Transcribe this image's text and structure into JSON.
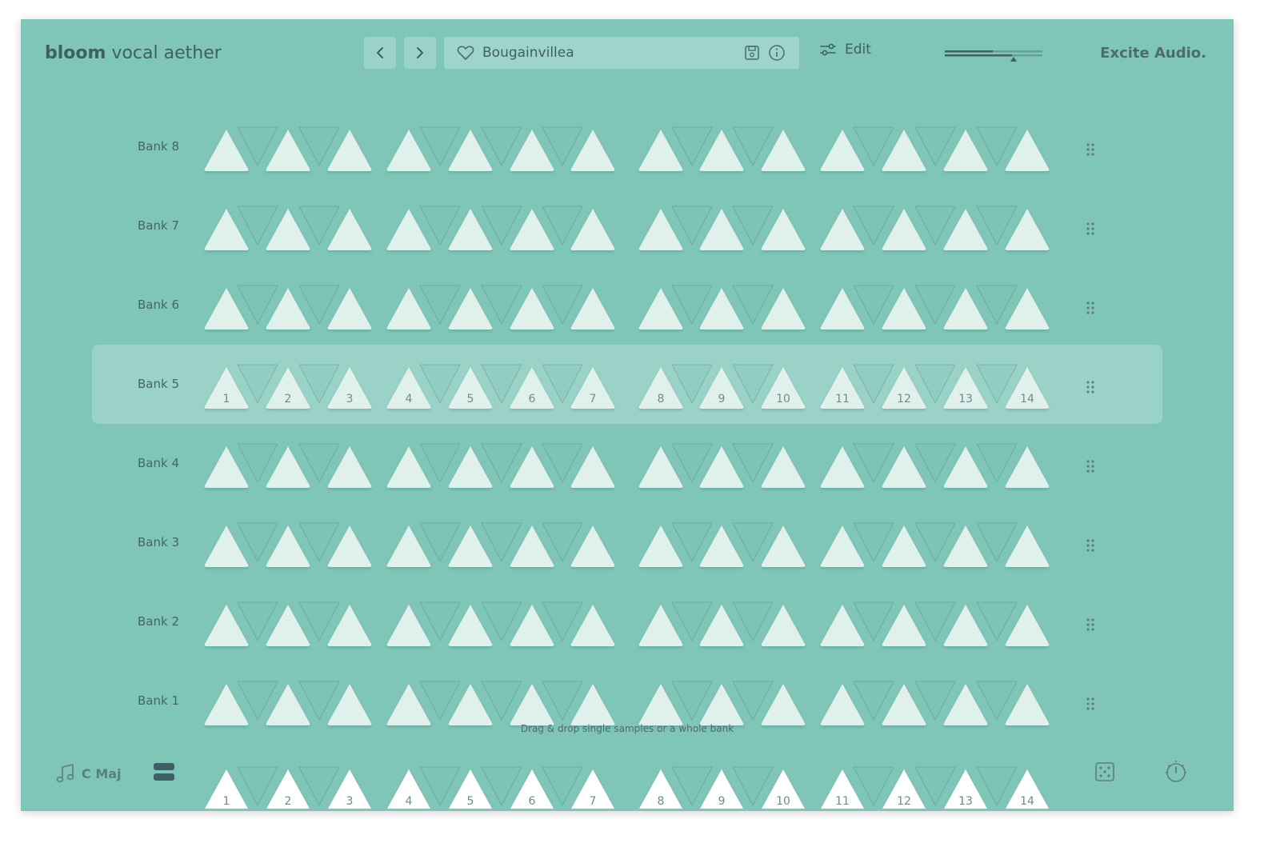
{
  "header": {
    "brand_bold": "bloom",
    "brand_light": "vocal aether",
    "preset_name": "Bougainvillea",
    "edit_label": "Edit",
    "vendor": "Excite Audio."
  },
  "banks": [
    {
      "label": "Bank 8",
      "active": false
    },
    {
      "label": "Bank 7",
      "active": false
    },
    {
      "label": "Bank 6",
      "active": false
    },
    {
      "label": "Bank 5",
      "active": true
    },
    {
      "label": "Bank 4",
      "active": false
    },
    {
      "label": "Bank 3",
      "active": false
    },
    {
      "label": "Bank 2",
      "active": false
    },
    {
      "label": "Bank 1",
      "active": false
    }
  ],
  "pad_numbers": [
    "1",
    "2",
    "3",
    "4",
    "5",
    "6",
    "7",
    "8",
    "9",
    "10",
    "11",
    "12",
    "13",
    "14"
  ],
  "hint": "Drag & drop single samples or a whole bank",
  "footer": {
    "scale_label": "C Maj"
  },
  "icons": {
    "prev": "chevron-left-icon",
    "next": "chevron-right-icon",
    "favorite": "heart-icon",
    "save": "save-icon",
    "info": "info-icon",
    "edit": "sliders-icon",
    "scale": "music-note-icon",
    "layers": "layers-icon",
    "randomize": "dice-icon",
    "settings": "timer-icon",
    "drag": "drag-handle-icon"
  },
  "colors": {
    "background": "#7fc6b8",
    "pad": "#e0f1ec",
    "text": "#3f5f66"
  }
}
